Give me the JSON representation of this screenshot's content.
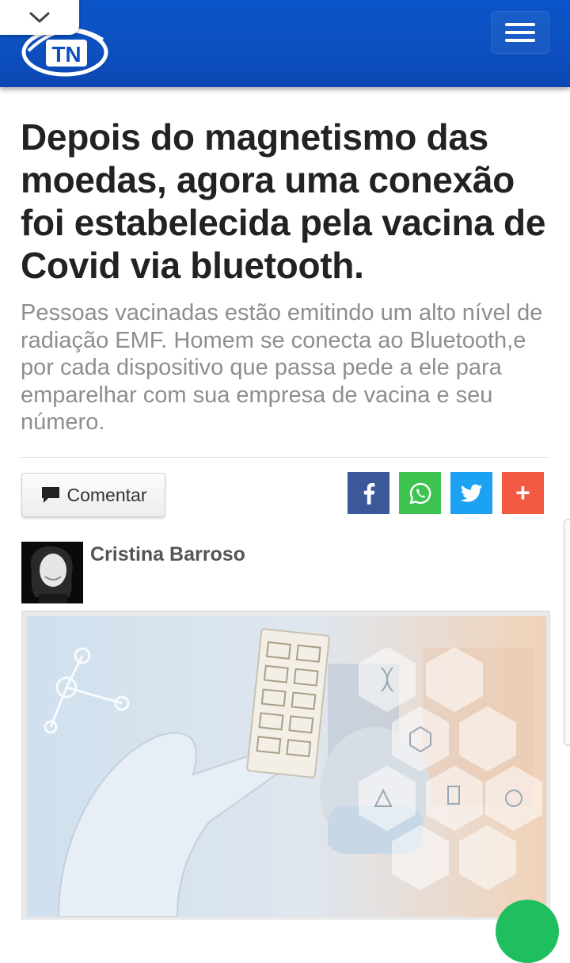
{
  "header": {
    "logo_text": "TN",
    "brand_color": "#0d4fbf",
    "collapse_icon": "chevron-down-icon",
    "menu_icon": "hamburger-menu-icon"
  },
  "article": {
    "title": "Depois do magnetismo das moedas, agora uma conexão foi estabelecida pela vacina de Covid via bluetooth.",
    "subtitle": "Pessoas vacinadas estão emitindo um alto nível de radiação EMF. Homem se conecta ao Bluetooth,e por cada dispositivo que passa pede a ele para emparelhar com sua empresa de vacina e seu número.",
    "comment_label": "Comentar",
    "share": {
      "facebook_icon": "facebook-icon",
      "whatsapp_icon": "whatsapp-icon",
      "twitter_icon": "twitter-icon",
      "more_label": "+"
    },
    "author": {
      "name": "Cristina Barroso"
    }
  }
}
